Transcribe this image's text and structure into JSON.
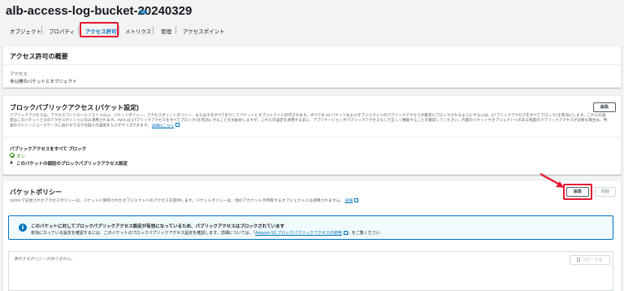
{
  "header": {
    "title": "alb-access-log-bucket-20240329",
    "info_label": "情報"
  },
  "tabs": [
    {
      "label": "オブジェクト"
    },
    {
      "label": "プロパティ"
    },
    {
      "label": "アクセス許可",
      "active": true
    },
    {
      "label": "メトリクス"
    },
    {
      "label": "管理"
    },
    {
      "label": "アクセスポイント"
    }
  ],
  "overview": {
    "title": "アクセス許可の概要",
    "access_label": "アクセス",
    "access_value": "非公開のバケットとオブジェクト"
  },
  "block_public": {
    "title": "ブロックパブリックアクセス (バケット設定)",
    "edit_label": "編集",
    "description_line1": "パブリックアクセスは、アクセスコントロールリスト (ACL)、バケットポリシー、アクセスポイントポリシー、またはそのすべてを介してバケットとオブジェクトに許可されます。すべての S3 バケットおよびオブジェクトへのパブリックアクセスが確実にブロックされるようにするには、[パブリックアクセスをすべてブロック] を有効にします。これらの設",
    "description_line2": "定はこのバケットとそのアクセスポイントにのみ適用されます。AWS は [パブリックアクセスをすべてブロック] を有効にすることをお勧めしますが、これらの設定を適用する前に、アプリケーションがパブリックアクセスなしで正しく機能することを確認してください。内部のバケットやオブジェクトへのある程度のパブリックアクセスが必要な場合は、特",
    "description_line3": "定のストレージユースケースに合わせて以下の個々の設定をカスタマイズできます。",
    "learn_more": "詳細はこちら",
    "block_all_label": "パブリックアクセスをすべて ブロック",
    "block_all_status": "オン",
    "expand_label": "このバケットの個別のブロックパブリックアクセス設定"
  },
  "bucket_policy": {
    "title": "バケットポリシー",
    "description": "JSON で記述されたアクセスポリシーは、バケットに保存されたオブジェクトへのアクセスを提供します。バケットポリシーは、他のアカウントが所有するオブジェクトには適用されません。",
    "learn_more": "詳細",
    "edit_label": "編集",
    "delete_label": "削除",
    "alert_title": "このバケットに対してブロックパブリックアクセス設定が有効になっているため、パブリックアクセスはブロックされています",
    "alert_text_before": "有効になっている設定を確認するには、このバケットのブロックパブリックアクセス設定を確認します。詳細については、「",
    "alert_link": "Amazon S3 ブロックパブリックアクセスの使用",
    "alert_text_after": "」をご覧ください",
    "editor_placeholder": "表示するポリシーがありません。",
    "copy_label": "コピーする"
  },
  "colors": {
    "accent": "#0073bb",
    "highlight": "#e8162f",
    "success": "#1d8102"
  }
}
